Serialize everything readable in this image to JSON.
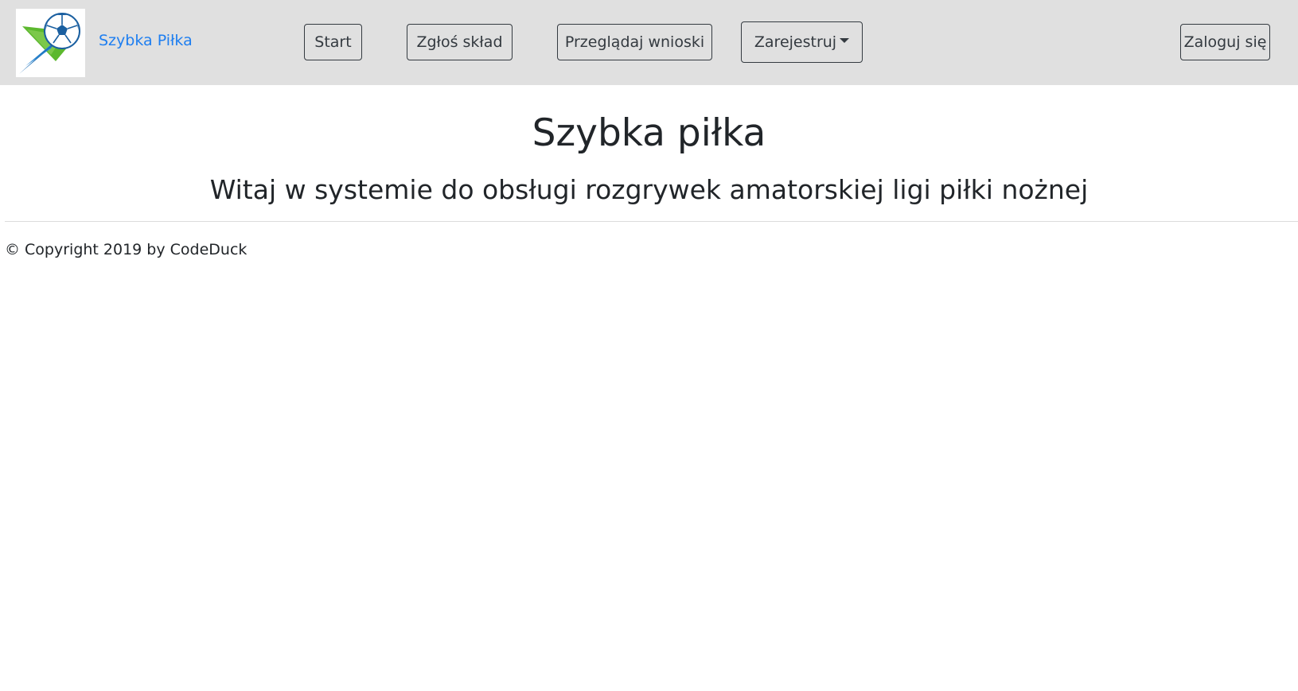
{
  "navbar": {
    "brand_label": "Szybka Piłka",
    "logo_icon": "soccer-ball-logo-icon",
    "buttons": {
      "start": "Start",
      "submit_team": "Zgłoś skład",
      "browse_requests": "Przeglądaj wnioski",
      "register": "Zarejestruj",
      "login": "Zaloguj się"
    },
    "background_color": "#e0e0e0",
    "brand_color": "#1e7ef0"
  },
  "main": {
    "title": "Szybka piłka",
    "subtitle": "Witaj w systemie do obsługi rozgrywek amatorskiej ligi piłki nożnej"
  },
  "footer": {
    "copyright": "© Copyright 2019 by CodeDuck"
  }
}
